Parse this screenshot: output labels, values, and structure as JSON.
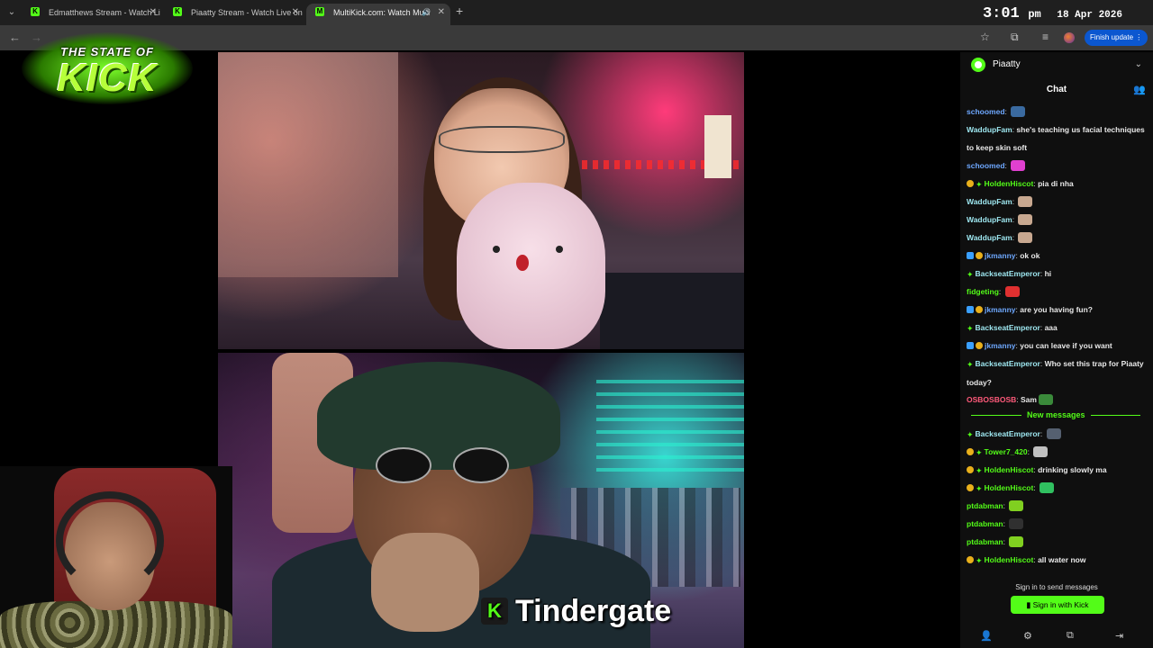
{
  "browser": {
    "tabs": [
      {
        "label": "Edmatthews Stream - Watch Li"
      },
      {
        "label": "Piaatty Stream - Watch Live on"
      },
      {
        "label": "MultiKick.com: Watch Multi"
      }
    ],
    "finish_update": "Finish update"
  },
  "clock": {
    "time": "3:01",
    "ampm": "pm",
    "date": "18 Apr 2026"
  },
  "logo": {
    "line1": "THE STATE OF",
    "line2": "KICK"
  },
  "caption": {
    "badge": "K",
    "text": "Tindergate"
  },
  "chat": {
    "channel": "Piaatty",
    "title": "Chat",
    "messages": [
      {
        "user": "schoomed",
        "color": "#6ea8ff",
        "text": "",
        "emote": "#3a6aa0",
        "badges": []
      },
      {
        "user": "WaddupFam",
        "color": "#9ee7f0",
        "text": "she's teaching us facial techniques to keep skin soft",
        "badges": [],
        "wrap": true
      },
      {
        "user": "schoomed",
        "color": "#6ea8ff",
        "text": "",
        "emote": "#e040d0",
        "badges": []
      },
      {
        "user": "HoldenHiscot",
        "color": "#53fc18",
        "text": "pia di nha",
        "badges": [
          "sub",
          "star"
        ]
      },
      {
        "user": "WaddupFam",
        "color": "#9ee7f0",
        "text": "",
        "emote": "#c8a890",
        "badges": []
      },
      {
        "user": "WaddupFam",
        "color": "#9ee7f0",
        "text": "",
        "emote": "#c8a890",
        "badges": []
      },
      {
        "user": "WaddupFam",
        "color": "#9ee7f0",
        "text": "",
        "emote": "#c8a890",
        "badges": []
      },
      {
        "user": "jkmanny",
        "color": "#6ea8ff",
        "text": "ok ok",
        "badges": [
          "mod",
          "sub"
        ]
      },
      {
        "user": "BackseatEmperor",
        "color": "#9ee7f0",
        "text": "hi",
        "badges": [
          "star"
        ]
      },
      {
        "user": "fidgeting",
        "color": "#53fc18",
        "text": "",
        "emote": "#e03030",
        "badges": []
      },
      {
        "user": "jkmanny",
        "color": "#6ea8ff",
        "text": "are you having fun?",
        "badges": [
          "mod",
          "sub"
        ]
      },
      {
        "user": "BackseatEmperor",
        "color": "#9ee7f0",
        "text": "aaa",
        "badges": [
          "star"
        ]
      },
      {
        "user": "jkmanny",
        "color": "#6ea8ff",
        "text": "you can leave if you want",
        "badges": [
          "mod",
          "sub"
        ]
      },
      {
        "user": "BackseatEmperor",
        "color": "#9ee7f0",
        "text": "Who set this trap for Piaaty today?",
        "badges": [
          "star"
        ],
        "wrap": true
      },
      {
        "user": "OSBOSBOSB",
        "color": "#ff5a7a",
        "text": "Sam",
        "emote": "#3a8a3a",
        "badges": []
      }
    ],
    "new_messages_label": "New messages",
    "new_messages": [
      {
        "user": "BackseatEmperor",
        "color": "#9ee7f0",
        "text": "",
        "emote": "#556070",
        "badges": [
          "star"
        ]
      },
      {
        "user": "Tower7_420",
        "color": "#53fc18",
        "text": "",
        "emote": "#c0c0c0",
        "badges": [
          "sub",
          "star"
        ]
      },
      {
        "user": "HoldenHiscot",
        "color": "#53fc18",
        "text": "drinking slowly ma",
        "badges": [
          "sub",
          "star"
        ]
      },
      {
        "user": "HoldenHiscot",
        "color": "#53fc18",
        "text": "",
        "emote": "#30c060",
        "badges": [
          "sub",
          "star"
        ]
      },
      {
        "user": "ptdabman",
        "color": "#53fc18",
        "text": "",
        "emote": "#80d020",
        "badges": []
      },
      {
        "user": "ptdabman",
        "color": "#53fc18",
        "text": "",
        "emote": "#303030",
        "badges": []
      },
      {
        "user": "ptdabman",
        "color": "#53fc18",
        "text": "",
        "emote": "#80d020",
        "badges": []
      },
      {
        "user": "HoldenHiscot",
        "color": "#53fc18",
        "text": "all water now",
        "badges": [
          "sub",
          "star"
        ]
      }
    ],
    "signin_note": "Sign in to send messages",
    "signin_button": "Sign in with Kick"
  }
}
